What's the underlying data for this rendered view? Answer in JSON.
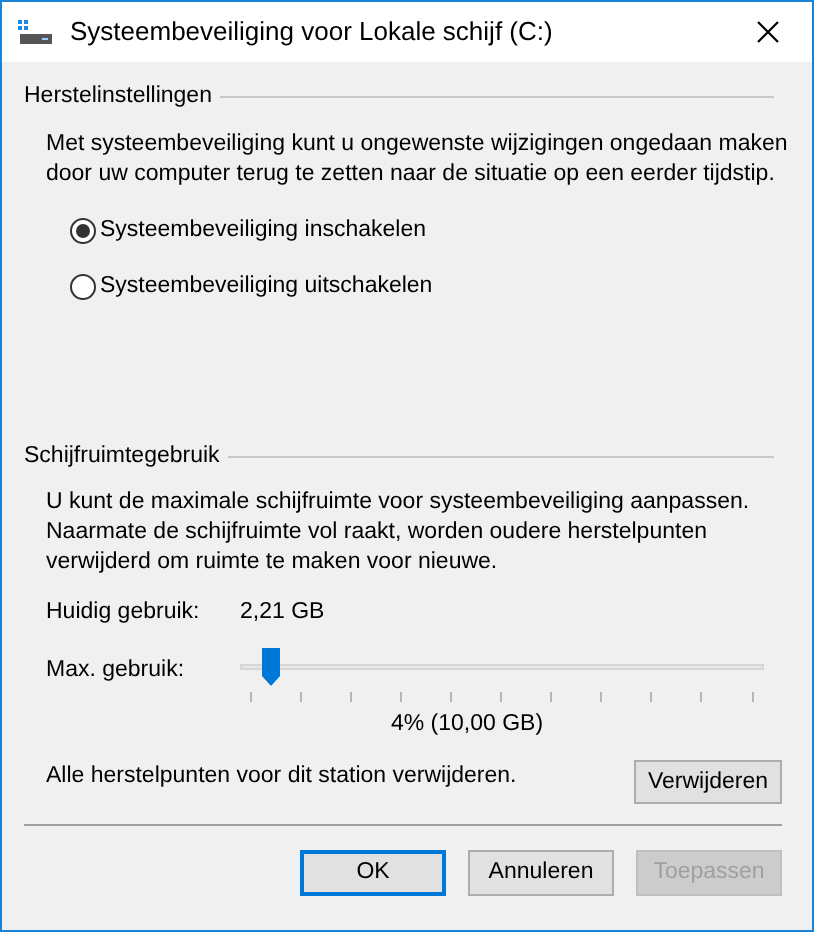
{
  "window": {
    "title": "Systeembeveiliging voor Lokale schijf (C:)"
  },
  "restore_settings": {
    "heading": "Herstelinstellingen",
    "description": "Met systeembeveiliging kunt u ongewenste wijzigingen ongedaan maken door uw computer terug te zetten naar de situatie op een eerder tijdstip.",
    "options": [
      {
        "label": "Systeembeveiliging inschakelen",
        "selected": true
      },
      {
        "label": "Systeembeveiliging uitschakelen",
        "selected": false
      }
    ]
  },
  "disk_usage": {
    "heading": "Schijfruimtegebruik",
    "description": "U kunt de maximale schijfruimte voor systeembeveiliging aanpassen. Naarmate de schijfruimte vol raakt, worden oudere herstelpunten verwijderd om ruimte te maken voor nieuwe.",
    "current_label": "Huidig gebruik:",
    "current_value": "2,21 GB",
    "max_label": "Max. gebruik:",
    "level": 0.04,
    "max_reading": "4% (10,00 GB)",
    "delete_text": "Alle herstelpunten voor dit station verwijderen.",
    "delete_button": "Verwijderen"
  },
  "buttons": [
    {
      "label": "OK",
      "default": true,
      "disabled": false
    },
    {
      "label": "Annuleren",
      "default": false,
      "disabled": false
    },
    {
      "label": "Toepassen",
      "default": false,
      "disabled": true
    }
  ]
}
